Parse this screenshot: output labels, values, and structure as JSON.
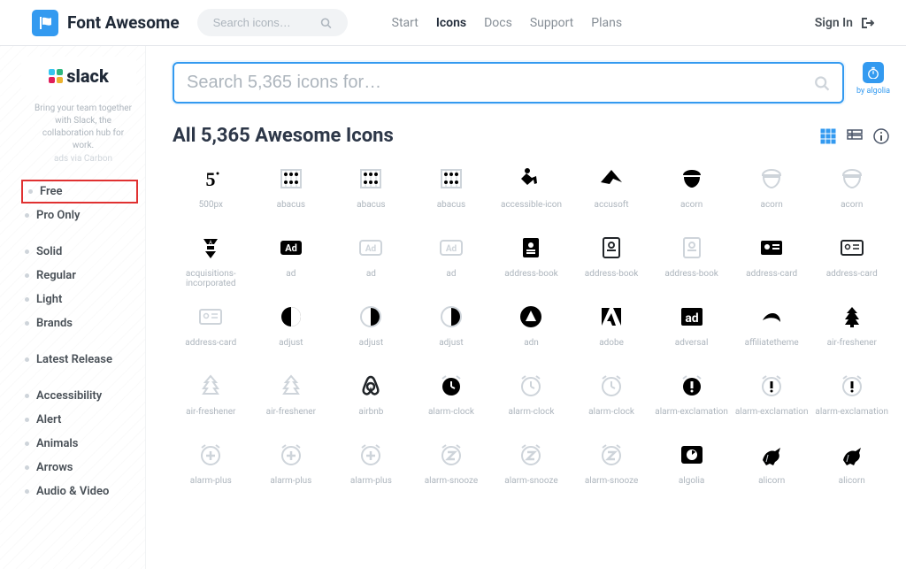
{
  "header": {
    "brand": "Font Awesome",
    "search_placeholder": "Search icons…",
    "nav": {
      "start": "Start",
      "icons": "Icons",
      "docs": "Docs",
      "support": "Support",
      "plans": "Plans"
    },
    "signin": "Sign In"
  },
  "sidebar": {
    "ad": {
      "brand": "slack",
      "caption": "Bring your team together with Slack, the collaboration hub for work.",
      "via": "ads via Carbon"
    },
    "filters_plan": {
      "free": "Free",
      "pro": "Pro Only"
    },
    "filters_style": {
      "solid": "Solid",
      "regular": "Regular",
      "light": "Light",
      "brands": "Brands"
    },
    "filters_release": {
      "latest": "Latest Release"
    },
    "filters_category": {
      "accessibility": "Accessibility",
      "alert": "Alert",
      "animals": "Animals",
      "arrows": "Arrows",
      "audio_video": "Audio & Video"
    }
  },
  "content": {
    "big_search_placeholder": "Search 5,365 icons for…",
    "algolia_by": "by algolia",
    "title": "All 5,365 Awesome Icons",
    "icons": {
      "r1": {
        "c1": "500px",
        "c2": "abacus",
        "c3": "abacus",
        "c4": "abacus",
        "c5": "accessible-icon",
        "c6": "accusoft",
        "c7": "acorn",
        "c8": "acorn",
        "c9": "acorn"
      },
      "r2": {
        "c1": "acquisitions-incorporated",
        "c2": "ad",
        "c3": "ad",
        "c4": "ad",
        "c5": "address-book",
        "c6": "address-book",
        "c7": "address-book",
        "c8": "address-card",
        "c9": "address-card"
      },
      "r3": {
        "c1": "address-card",
        "c2": "adjust",
        "c3": "adjust",
        "c4": "adjust",
        "c5": "adn",
        "c6": "adobe",
        "c7": "adversal",
        "c8": "affiliatetheme",
        "c9": "air-freshener"
      },
      "r4": {
        "c1": "air-freshener",
        "c2": "air-freshener",
        "c3": "airbnb",
        "c4": "alarm-clock",
        "c5": "alarm-clock",
        "c6": "alarm-clock",
        "c7": "alarm-exclamation",
        "c8": "alarm-exclamation",
        "c9": "alarm-exclamation"
      },
      "r5": {
        "c1": "alarm-plus",
        "c2": "alarm-plus",
        "c3": "alarm-plus",
        "c4": "alarm-snooze",
        "c5": "alarm-snooze",
        "c6": "alarm-snooze",
        "c7": "algolia",
        "c8": "alicorn",
        "c9": "alicorn"
      }
    }
  }
}
